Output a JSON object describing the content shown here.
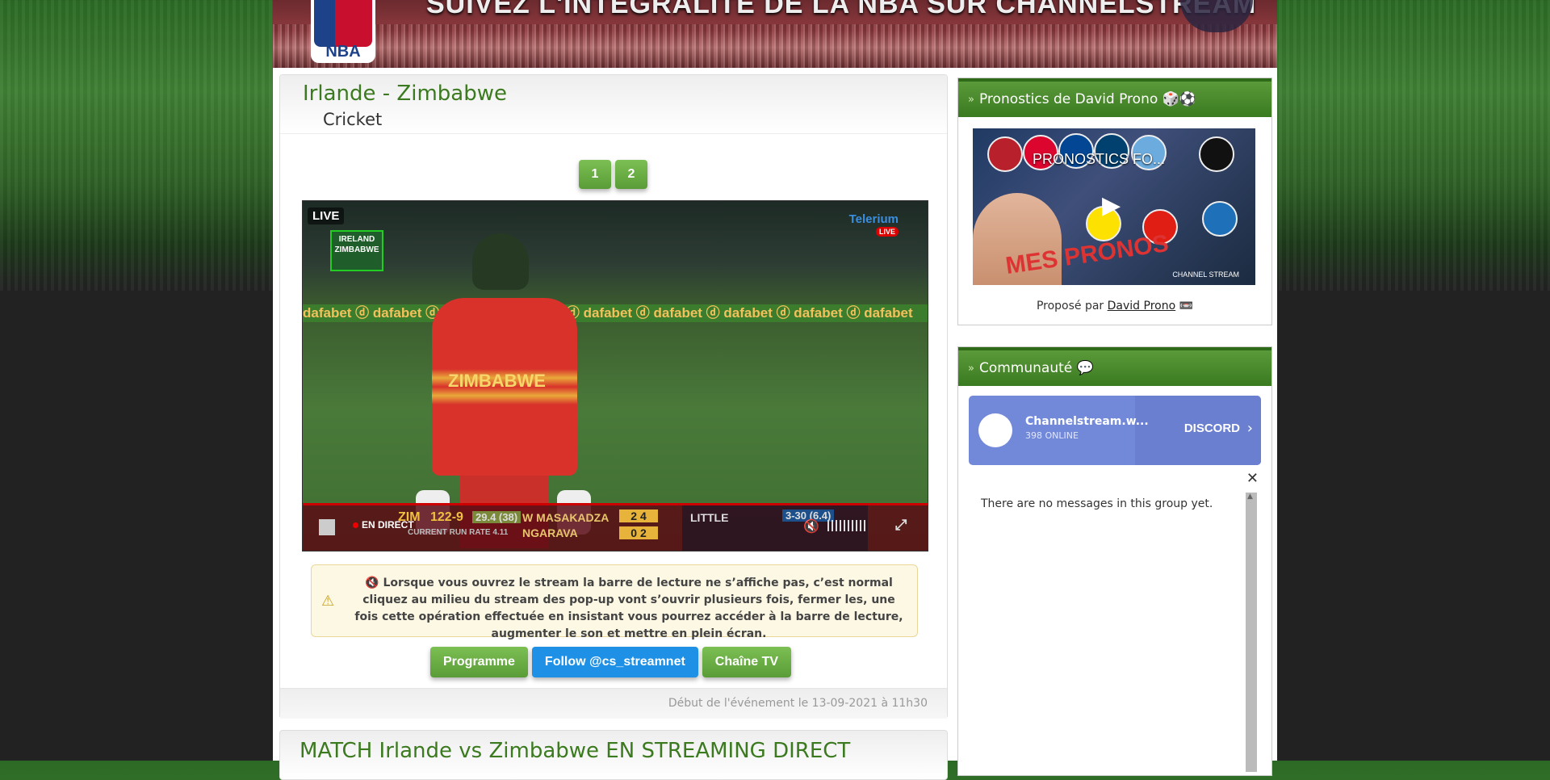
{
  "banner": {
    "headline": "SUIVEZ L'INTÉGRALITÉ DE LA NBA SUR CHANNELSTREAM",
    "logo_text": "NBA"
  },
  "event": {
    "title": "Irlande - Zimbabwe",
    "sport": "Cricket",
    "pages": [
      "1",
      "2"
    ]
  },
  "video": {
    "live_label": "LIVE",
    "badge_text": "IRELAND ZIMBABWE",
    "channel_logo": "Telerium",
    "channel_live": "LIVE",
    "ad_board": "dafabet  ⓓ dafabet  ⓓ dafabet  ⓓ dafabet  ⓓ dafabet  ⓓ dafabet  ⓓ dafabet  ⓓ dafabet  ⓓ dafabet",
    "jersey_text": "ZIMBABWE",
    "score": {
      "team": "ZIM",
      "runs": "122-9",
      "overs": "29.4 (38)",
      "batsman1": "W MASAKADZA",
      "batsman2": "NGARAVA",
      "b1_score": "2  4",
      "b2_score": "0  2",
      "crr": "CURRENT RUN RATE 4.11",
      "bowler": "LITTLE",
      "bowler_fig": "3-30 (6.4)"
    },
    "controls": {
      "live_text": "EN DIRECT"
    }
  },
  "warning": {
    "text": "🔇 Lorsque vous ouvrez le stream la barre de lecture ne s’affiche pas, c’est normal cliquez au milieu du stream des pop-up vont s’ouvrir plusieurs fois, fermer les, une fois cette opération effectuée en insistant vous pourrez accéder à la barre de lecture, augmenter le son et mettre en plein écran."
  },
  "buttons": {
    "programme": "Programme",
    "follow": "Follow @cs_streamnet",
    "chaine": "Chaîne TV"
  },
  "footer": {
    "start": "Début de l'événement le 13-09-2021 à 11h30"
  },
  "second": {
    "title": "MATCH Irlande vs Zimbabwe EN STREAMING DIRECT"
  },
  "sidebar": {
    "prono_title": "Pronostics de David Prono 🎲⚽",
    "video_title": "PRONOSTICS FO...",
    "video_overlay": "MES PRONOS",
    "video_brand": "CHANNEL STREAM",
    "proposed_prefix": "Proposé par ",
    "proposed_author": "David Prono",
    "proposed_suffix": " 📼",
    "community_title": "Communauté 💬",
    "discord_name": "Channelstream.w...",
    "discord_online": "398 ONLINE",
    "discord_label": "DISCORD",
    "no_messages": "There are no messages in this group yet."
  },
  "colors": {
    "accent_green": "#5a9c37",
    "title_green": "#3b7a1f",
    "twitter_blue": "#1e90e6",
    "discord": "#7289da"
  }
}
